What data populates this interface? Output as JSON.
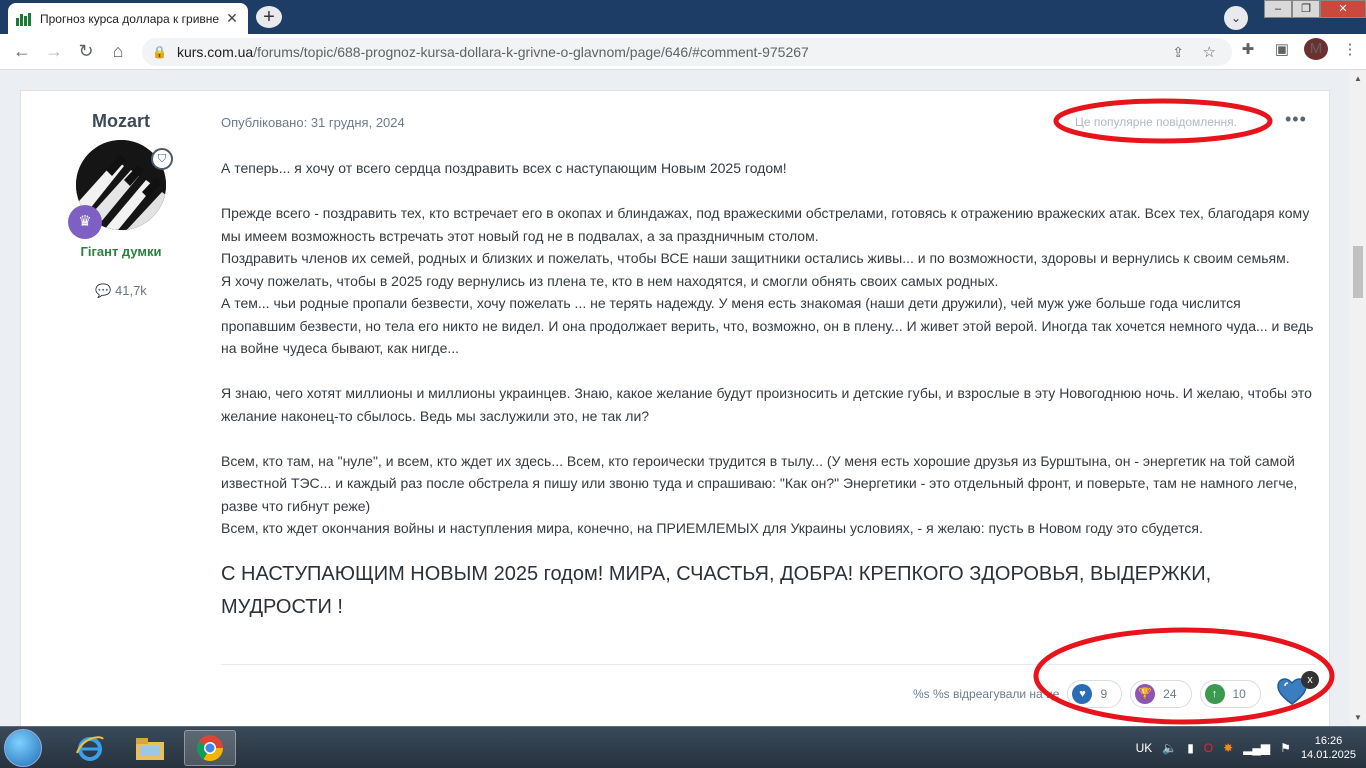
{
  "browser": {
    "tab_title": "Прогноз курса доллара к гривне",
    "url_domain": "kurs.com.ua",
    "url_path": "/forums/topic/688-prognoz-kursa-dollara-k-grivne-o-glavnom/page/646/#comment-975267",
    "profile_initial": "M"
  },
  "post": {
    "author": "Mozart",
    "rank": "Гігант думки",
    "content_count": "41,7k",
    "published": "Опубліковано: 31 грудня, 2024",
    "popular_label": "Це популярне повідомлення.",
    "paragraphs": [
      "А теперь... я хочу от всего сердца поздравить всех с наступающим Новым 2025 годом!",
      "",
      "Прежде всего - поздравить тех, кто встречает его в окопах и блиндажах, под вражескими обстрелами, готовясь к отражению вражеских атак. Всех тех, благодаря кому мы имеем возможность встречать этот новый год не в подвалах, а за праздничным столом.",
      "Поздравить членов их семей, родных и близких и пожелать, чтобы ВСЕ наши защитники остались живы... и по возможности, здоровы и вернулись к своим семьям.",
      "Я хочу пожелать, чтобы в 2025 году вернулись из плена те, кто в нем находятся, и смогли обнять своих самых родных.",
      "А тем... чьи родные пропали безвести, хочу пожелать ... не терять надежду. У меня есть знакомая (наши дети дружили), чей муж уже больше года числится пропавшим безвести, но тела его никто не видел. И она продолжает верить, что, возможно, он в плену... И живет этой верой. Иногда так хочется немного чуда... и ведь на войне чудеса бывают, как нигде...",
      "",
      "Я знаю, чего хотят миллионы и миллионы украинцев. Знаю, какое желание будут произносить и детские губы, и взрослые в эту Новогоднюю ночь. И желаю, чтобы это желание наконец-то сбылось. Ведь мы заслужили это, не так ли?",
      "",
      "Всем, кто там, на \"нуле\", и всем, кто ждет их здесь... Всем, кто героически трудится в тылу... (У меня есть хорошие друзья из Бурштына, он - энергетик на той самой известной ТЭС... и каждый раз после обстрела я пишу или звоню туда и спрашиваю: \"Как он?\" Энергетики - это отдельный фронт, и поверьте, там не намного легче, разве что гибнут реже)",
      "Всем, кто ждет окончания войны и наступления мира, конечно, на ПРИЕМЛЕМЫХ для Украины условиях, - я желаю: пусть в Новом году это сбудется."
    ],
    "headline": "С НАСТУПАЮЩИМ НОВЫМ 2025 годом! МИРА, СЧАСТЬЯ, ДОБРА! КРЕПКОГО ЗДОРОВЬЯ, ВЫДЕРЖКИ, МУДРОСТИ !",
    "reacted_text": "%s %s відреагували на це",
    "reactions": [
      {
        "icon": "heart-icon",
        "count": "9",
        "color": "#2a6db5"
      },
      {
        "icon": "trophy-icon",
        "count": "24",
        "color": "#8e55b3"
      },
      {
        "icon": "upvote-icon",
        "count": "10",
        "color": "#3b9a4f"
      }
    ],
    "close_mark": "x"
  },
  "taskbar": {
    "lang": "UK",
    "time": "16:26",
    "date": "14.01.2025"
  }
}
